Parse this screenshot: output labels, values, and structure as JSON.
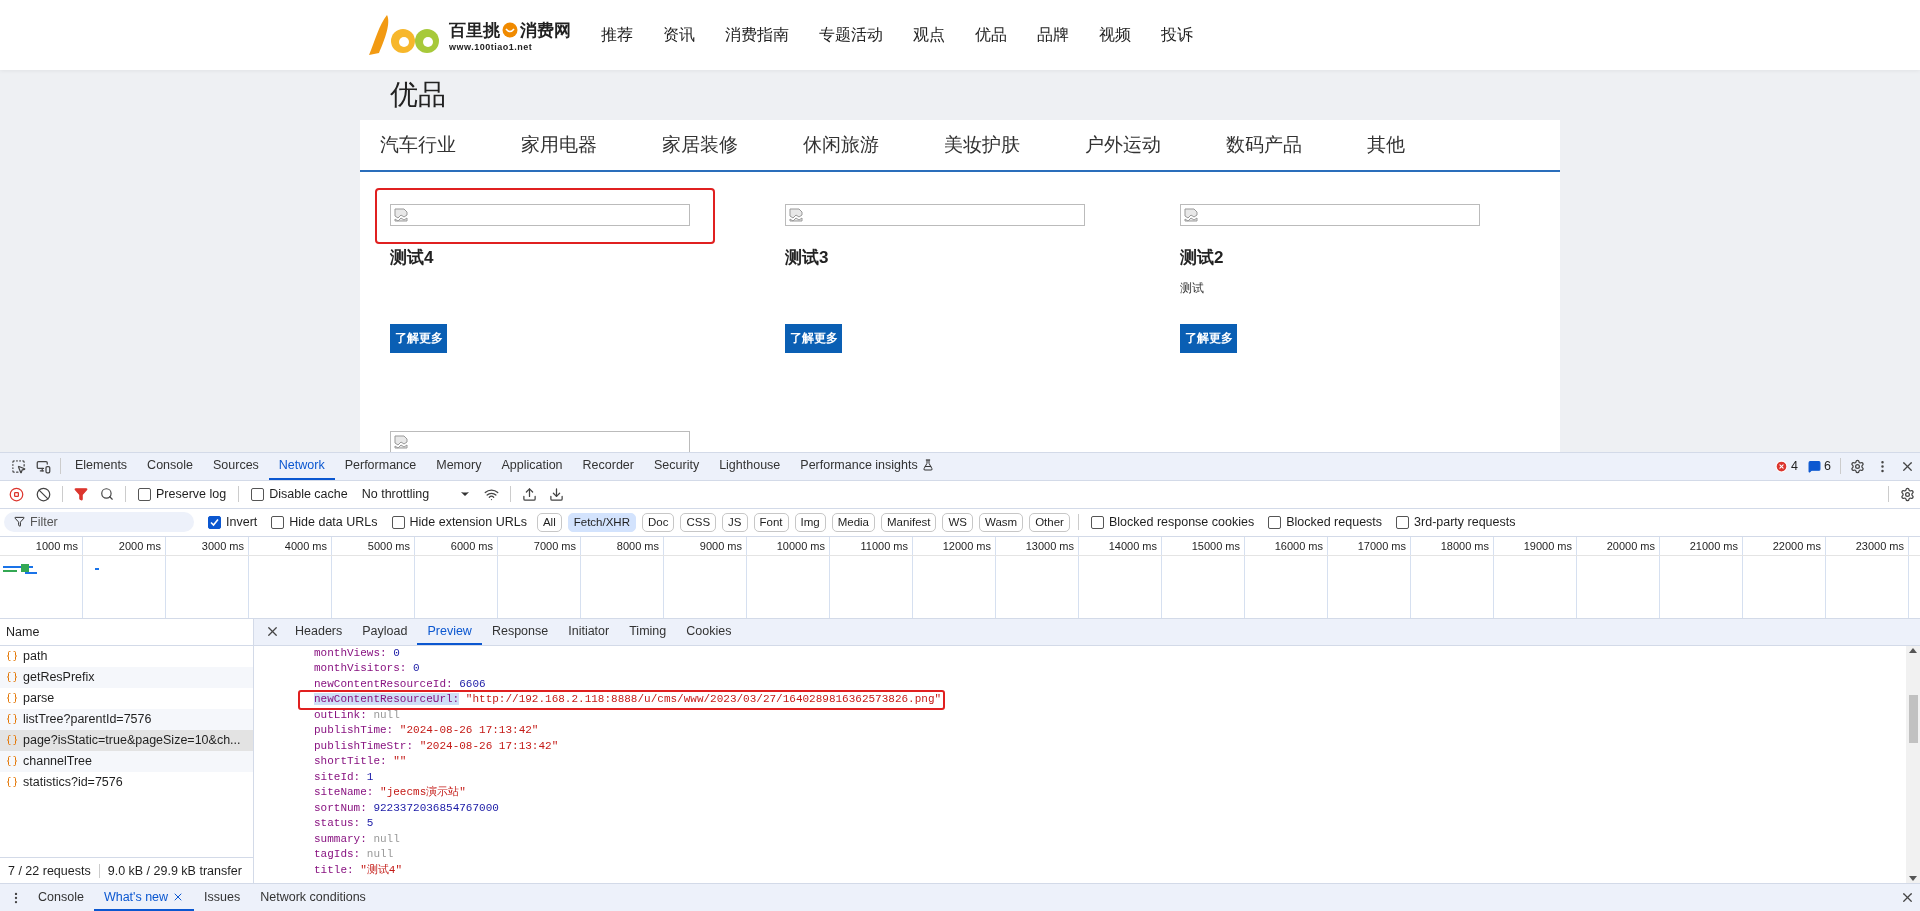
{
  "site": {
    "logo": {
      "name_left": "百里挑",
      "name_right": "消费网",
      "url": "www.100tiao1.net"
    },
    "nav": [
      {
        "label": "推荐",
        "selected": false
      },
      {
        "label": "资讯",
        "selected": false
      },
      {
        "label": "消费指南",
        "selected": false
      },
      {
        "label": "专题活动",
        "selected": false
      },
      {
        "label": "观点",
        "selected": false
      },
      {
        "label": "优品",
        "selected": false
      },
      {
        "label": "品牌",
        "selected": false
      },
      {
        "label": "视频",
        "selected": false
      },
      {
        "label": "投诉",
        "selected": false
      }
    ],
    "page_title": "优品",
    "categories": [
      {
        "label": "汽车行业",
        "selected": false
      },
      {
        "label": "家用电器",
        "selected": false
      },
      {
        "label": "家居装修",
        "selected": false
      },
      {
        "label": "休闲旅游",
        "selected": false
      },
      {
        "label": "美妆护肤",
        "selected": false
      },
      {
        "label": "户外运动",
        "selected": false
      },
      {
        "label": "数码产品",
        "selected": false
      },
      {
        "label": "其他",
        "selected": false
      }
    ],
    "cards": [
      {
        "title": "测试4",
        "button": "了解更多",
        "highlighted": true
      },
      {
        "title": "测试3",
        "button": "了解更多",
        "highlighted": false
      },
      {
        "title": "测试2",
        "summary": "测试",
        "button": "了解更多",
        "highlighted": false
      },
      {
        "highlighted": false
      }
    ]
  },
  "devtools": {
    "tabs": [
      {
        "label": "Elements",
        "selected": false
      },
      {
        "label": "Console",
        "selected": false
      },
      {
        "label": "Sources",
        "selected": false
      },
      {
        "label": "Network",
        "selected": true
      },
      {
        "label": "Performance",
        "selected": false
      },
      {
        "label": "Memory",
        "selected": false
      },
      {
        "label": "Application",
        "selected": false
      },
      {
        "label": "Recorder",
        "selected": false
      },
      {
        "label": "Security",
        "selected": false
      },
      {
        "label": "Lighthouse",
        "selected": false
      },
      {
        "label": "Performance insights",
        "selected": false
      }
    ],
    "errors": "4",
    "messages": "6",
    "toolbar": {
      "preserve_log": {
        "label": "Preserve log",
        "checked": false
      },
      "disable_cache": {
        "label": "Disable cache",
        "checked": false
      },
      "throttling": "No throttling"
    },
    "filter": {
      "placeholder": "Filter",
      "checks_left": [
        {
          "label": "Invert",
          "checked": true
        },
        {
          "label": "Hide data URLs",
          "checked": false
        },
        {
          "label": "Hide extension URLs",
          "checked": false
        }
      ],
      "types": [
        {
          "label": "All",
          "selected": false
        },
        {
          "label": "Fetch/XHR",
          "selected": true
        },
        {
          "label": "Doc",
          "selected": false
        },
        {
          "label": "CSS",
          "selected": false
        },
        {
          "label": "JS",
          "selected": false
        },
        {
          "label": "Font",
          "selected": false
        },
        {
          "label": "Img",
          "selected": false
        },
        {
          "label": "Media",
          "selected": false
        },
        {
          "label": "Manifest",
          "selected": false
        },
        {
          "label": "WS",
          "selected": false
        },
        {
          "label": "Wasm",
          "selected": false
        },
        {
          "label": "Other",
          "selected": false
        }
      ],
      "checks_right": [
        {
          "label": "Blocked response cookies",
          "checked": false
        },
        {
          "label": "Blocked requests",
          "checked": false
        },
        {
          "label": "3rd-party requests",
          "checked": false
        }
      ]
    },
    "timeline_ticks": [
      "1000 ms",
      "2000 ms",
      "3000 ms",
      "4000 ms",
      "5000 ms",
      "6000 ms",
      "7000 ms",
      "8000 ms",
      "9000 ms",
      "10000 ms",
      "11000 ms",
      "12000 ms",
      "13000 ms",
      "14000 ms",
      "15000 ms",
      "16000 ms",
      "17000 ms",
      "18000 ms",
      "19000 ms",
      "20000 ms",
      "21000 ms",
      "22000 ms",
      "23000 ms"
    ],
    "name_header": "Name",
    "requests": [
      {
        "name": "path",
        "selected": false
      },
      {
        "name": "getResPrefix",
        "selected": false
      },
      {
        "name": "parse",
        "selected": false
      },
      {
        "name": "listTree?parentId=7576",
        "selected": false
      },
      {
        "name": "page?isStatic=true&pageSize=10&ch...",
        "selected": true
      },
      {
        "name": "channelTree",
        "selected": false
      },
      {
        "name": "statistics?id=7576",
        "selected": false
      }
    ],
    "summary": {
      "requests": "7 / 22 requests",
      "transfer": "9.0 kB / 29.9 kB transfer"
    },
    "detail_tabs": [
      {
        "label": "Headers",
        "selected": false
      },
      {
        "label": "Payload",
        "selected": false
      },
      {
        "label": "Preview",
        "selected": true
      },
      {
        "label": "Response",
        "selected": false
      },
      {
        "label": "Initiator",
        "selected": false
      },
      {
        "label": "Timing",
        "selected": false
      },
      {
        "label": "Cookies",
        "selected": false
      }
    ],
    "preview": [
      {
        "key": "monthViews:",
        "value": "0",
        "kind": "number",
        "highlighted": false
      },
      {
        "key": "monthVisitors:",
        "value": "0",
        "kind": "number",
        "highlighted": false
      },
      {
        "key": "newContentResourceId:",
        "value": "6606",
        "kind": "number",
        "highlighted": false
      },
      {
        "key": "newContentResourceUrl:",
        "value": "\"http://192.168.2.118:8888/u/cms/www/2023/03/27/1640289816362573826.png\"",
        "kind": "string",
        "highlighted": true
      },
      {
        "key": "outLink:",
        "value": "null",
        "kind": "null",
        "highlighted": false
      },
      {
        "key": "publishTime:",
        "value": "\"2024-08-26 17:13:42\"",
        "kind": "string",
        "highlighted": false
      },
      {
        "key": "publishTimeStr:",
        "value": "\"2024-08-26 17:13:42\"",
        "kind": "string",
        "highlighted": false
      },
      {
        "key": "shortTitle:",
        "value": "\"\"",
        "kind": "string",
        "highlighted": false
      },
      {
        "key": "siteId:",
        "value": "1",
        "kind": "number",
        "highlighted": false
      },
      {
        "key": "siteName:",
        "value": "\"jeecms演示站\"",
        "kind": "string",
        "highlighted": false
      },
      {
        "key": "sortNum:",
        "value": "9223372036854767000",
        "kind": "number",
        "highlighted": false
      },
      {
        "key": "status:",
        "value": "5",
        "kind": "number",
        "highlighted": false
      },
      {
        "key": "summary:",
        "value": "null",
        "kind": "null",
        "highlighted": false
      },
      {
        "key": "tagIds:",
        "value": "null",
        "kind": "null",
        "highlighted": false
      },
      {
        "key": "title:",
        "value": "\"测试4\"",
        "kind": "string",
        "highlighted": false
      }
    ],
    "drawer_tabs": [
      {
        "label": "Console",
        "selected": false,
        "closable": false
      },
      {
        "label": "What's new",
        "selected": true,
        "closable": true
      },
      {
        "label": "Issues",
        "selected": false,
        "closable": false
      },
      {
        "label": "Network conditions",
        "selected": false,
        "closable": false
      }
    ]
  }
}
